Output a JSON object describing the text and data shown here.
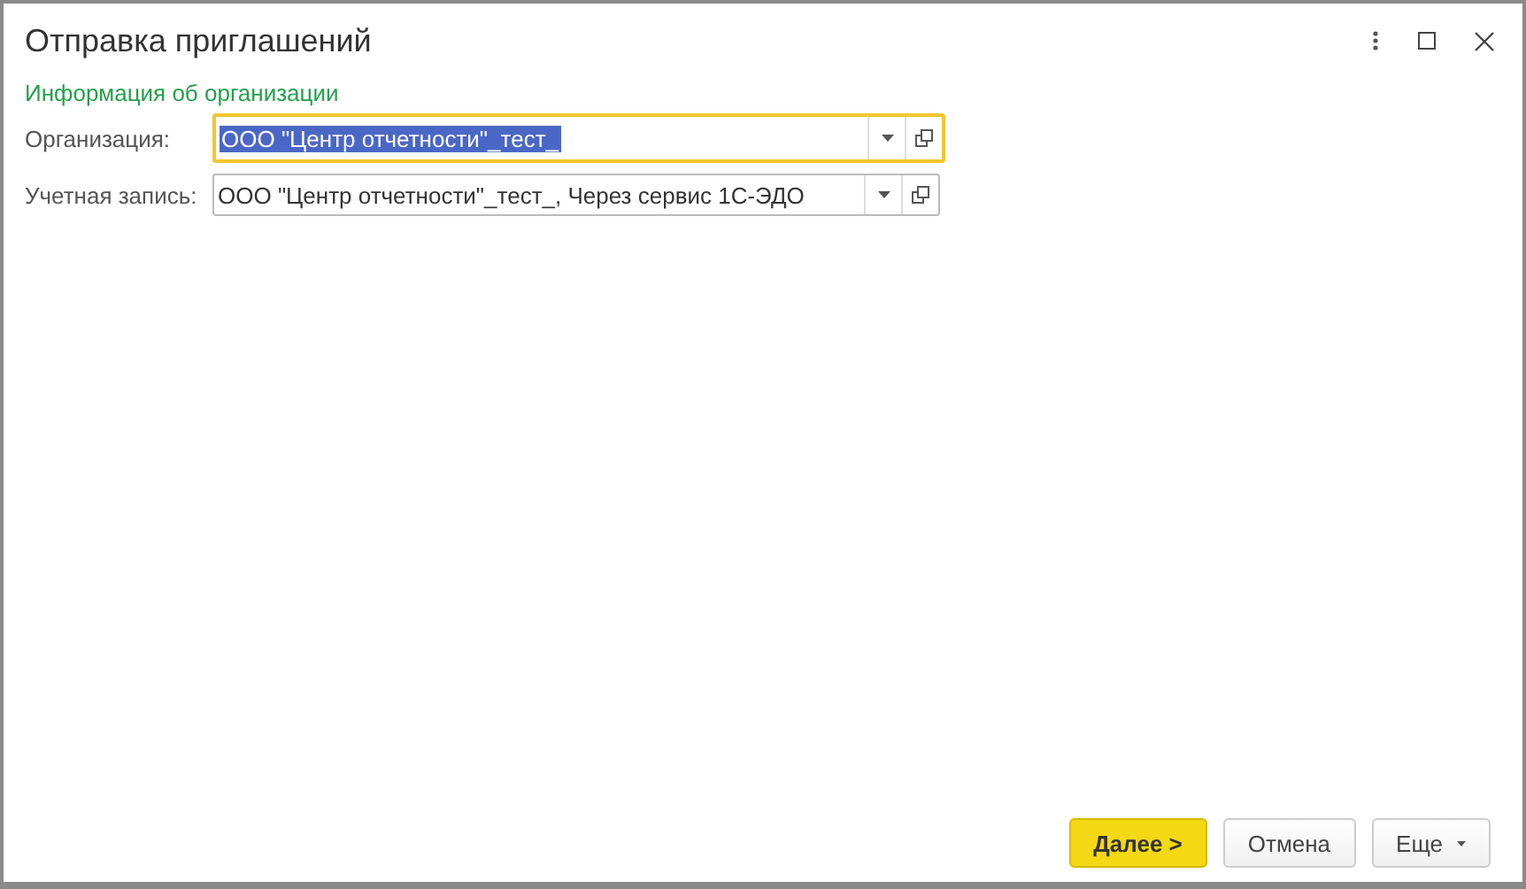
{
  "window": {
    "title": "Отправка приглашений"
  },
  "section": {
    "title": "Информация об организации"
  },
  "fields": [
    {
      "label": "Организация:",
      "value": "ООО \"Центр отчетности\"_тест_",
      "focused": true
    },
    {
      "label": "Учетная запись:",
      "value": "ООО \"Центр отчетности\"_тест_, Через сервис 1С-ЭДО",
      "focused": false
    }
  ],
  "buttons": [
    {
      "label": "Далее >",
      "kind": "primary"
    },
    {
      "label": "Отмена",
      "kind": "plain"
    },
    {
      "label": "Еще",
      "kind": "menu"
    }
  ]
}
